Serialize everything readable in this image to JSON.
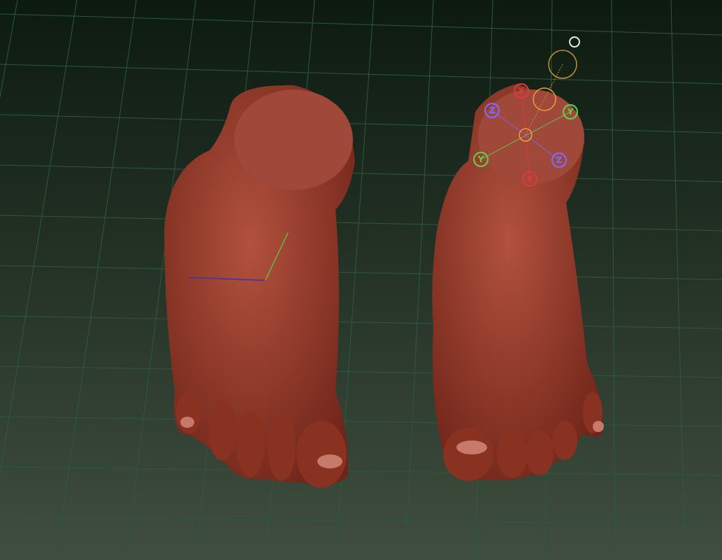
{
  "viewport": {
    "gizmo": {
      "handles": [
        {
          "label": "X",
          "color": "#e03a3a"
        },
        {
          "label": "X",
          "color": "#e03a3a"
        },
        {
          "label": "Y",
          "color": "#5fd04a"
        },
        {
          "label": "Y",
          "color": "#5fd04a"
        },
        {
          "label": "Z",
          "color": "#7a6cff"
        },
        {
          "label": "Z",
          "color": "#7a6cff"
        }
      ]
    }
  }
}
